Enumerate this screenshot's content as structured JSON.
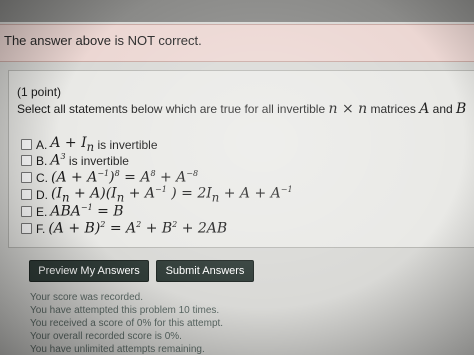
{
  "notice": {
    "text": "The answer above is NOT correct."
  },
  "problem": {
    "points": "(1 point)",
    "question_prefix": "Select all statements below which are true for all invertible",
    "question_math_1": "n × n",
    "question_mid": "matrices",
    "question_math_2": "A",
    "question_and": "and",
    "question_math_3": "B",
    "options": [
      {
        "letter": "A.",
        "math": "A + I",
        "sub": "n",
        "text": "is invertible"
      },
      {
        "letter": "B.",
        "math": "A",
        "sup": "3",
        "text": "is invertible"
      },
      {
        "letter": "C.",
        "math": "(A + A",
        "sup1": "−1",
        "math2": ")",
        "sup2": "8",
        "math3": "= A",
        "sup3": "8",
        "math4": "+ A",
        "sup4": "−8"
      },
      {
        "letter": "D.",
        "math": "(I",
        "sub1": "n",
        "math2": "+ A)(I",
        "sub2": "n",
        "math3": "+ A",
        "sup1": "−1",
        "math4": ") = 2I",
        "sub3": "n",
        "math5": "+ A + A",
        "sup2": "−1"
      },
      {
        "letter": "E.",
        "math": "ABA",
        "sup": "−1",
        "math2": "= B"
      },
      {
        "letter": "F.",
        "math": "(A + B)",
        "sup1": "2",
        "math2": "= A",
        "sup2": "2",
        "math3": "+ B",
        "sup3": "2",
        "math4": "+ 2AB"
      }
    ]
  },
  "buttons": {
    "preview": "Preview My Answers",
    "submit": "Submit Answers"
  },
  "status": [
    "Your score was recorded.",
    "You have attempted this problem 10 times.",
    "You received a score of 0% for this attempt.",
    "Your overall recorded score is 0%.",
    "You have unlimited attempts remaining."
  ]
}
